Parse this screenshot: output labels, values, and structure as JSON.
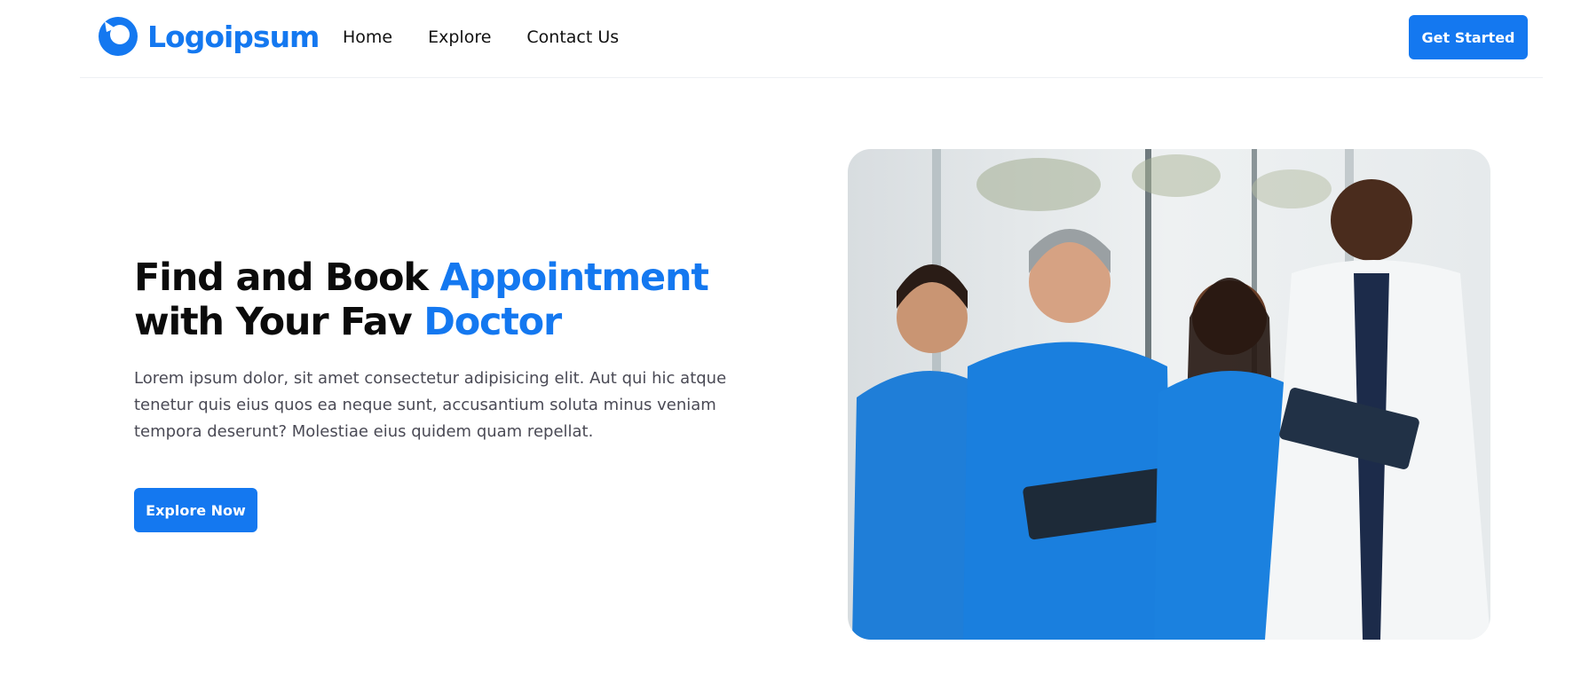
{
  "header": {
    "logo_text": "Logoipsum",
    "nav": [
      {
        "label": "Home"
      },
      {
        "label": "Explore"
      },
      {
        "label": "Contact Us"
      }
    ],
    "cta_label": "Get Started"
  },
  "hero": {
    "title_part1": "Find and Book ",
    "title_accent1": "Appointment",
    "title_part2": " with Your Fav ",
    "title_accent2": "Doctor",
    "description": "Lorem ipsum dolor, sit amet consectetur adipisicing elit. Aut qui hic atque tenetur quis eius quos ea neque sunt, accusantium soluta minus veniam tempora deserunt? Molestiae eius quidem quam repellat.",
    "button_label": "Explore Now",
    "image_icon": "doctors-team-photo"
  },
  "colors": {
    "accent": "#1478f0",
    "text": "#0b0b0b",
    "muted": "#4a4a55"
  }
}
